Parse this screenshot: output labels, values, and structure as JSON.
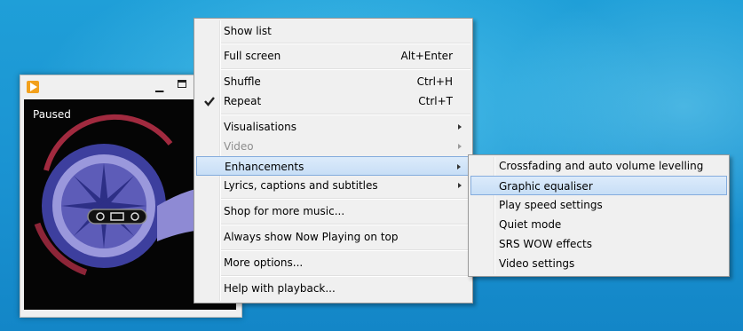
{
  "player": {
    "status": "Paused",
    "icons": {
      "app": "media-player-icon",
      "minimize": "minimize-icon",
      "maximize": "maximize-icon"
    }
  },
  "menu": {
    "items": [
      {
        "label": "Show list",
        "shortcut": ""
      },
      {
        "label": "Full screen",
        "shortcut": "Alt+Enter"
      },
      {
        "label": "Shuffle",
        "shortcut": "Ctrl+H"
      },
      {
        "label": "Repeat",
        "shortcut": "Ctrl+T",
        "checked": true
      },
      {
        "label": "Visualisations",
        "submenu": true
      },
      {
        "label": "Video",
        "submenu": true,
        "disabled": true
      },
      {
        "label": "Enhancements",
        "submenu": true,
        "highlighted": true
      },
      {
        "label": "Lyrics, captions and subtitles",
        "submenu": true
      },
      {
        "label": "Shop for more music..."
      },
      {
        "label": "Always show Now Playing on top"
      },
      {
        "label": "More options..."
      },
      {
        "label": "Help with playback..."
      }
    ]
  },
  "submenu": {
    "items": [
      {
        "label": "Crossfading and auto volume levelling"
      },
      {
        "label": "Graphic equaliser",
        "highlighted": true
      },
      {
        "label": "Play speed settings"
      },
      {
        "label": "Quiet mode"
      },
      {
        "label": "SRS WOW effects"
      },
      {
        "label": "Video settings"
      }
    ]
  },
  "colors": {
    "highlight_bg": "#cfe3f8",
    "highlight_border": "#84acdd",
    "menu_bg": "#f0f0f0",
    "desktop": "#1a92d1"
  }
}
